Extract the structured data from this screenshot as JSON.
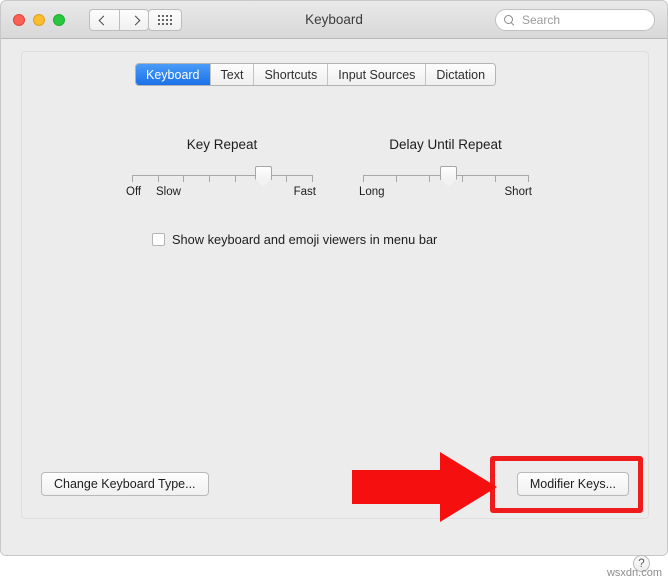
{
  "window": {
    "title": "Keyboard",
    "traffic_lights": [
      "close",
      "minimize",
      "maximize"
    ],
    "nav": {
      "back_icon": "chevron-left-icon",
      "forward_icon": "chevron-right-icon",
      "grid_icon": "show-all-grid-icon"
    },
    "search": {
      "placeholder": "Search",
      "value": "",
      "icon": "search-icon"
    }
  },
  "tabs": [
    {
      "label": "Keyboard",
      "active": true
    },
    {
      "label": "Text",
      "active": false
    },
    {
      "label": "Shortcuts",
      "active": false
    },
    {
      "label": "Input Sources",
      "active": false
    },
    {
      "label": "Dictation",
      "active": false
    }
  ],
  "sliders": [
    {
      "title": "Key Repeat",
      "left_label": "Off",
      "second_label": "Slow",
      "right_label": "Fast",
      "ticks": 8,
      "knob_percent": 73
    },
    {
      "title": "Delay Until Repeat",
      "left_label": "Long",
      "right_label": "Short",
      "ticks": 6,
      "knob_percent": 52
    }
  ],
  "checkbox": {
    "label": "Show keyboard and emoji viewers in menu bar",
    "checked": false
  },
  "buttons": {
    "change_keyboard_type": "Change Keyboard Type...",
    "modifier_keys": "Modifier Keys..."
  },
  "annotations": {
    "highlight_color": "#ee1c1c",
    "arrow_color": "#f60f0f",
    "arrow_points_to": "modifier-keys-button"
  },
  "help": {
    "label": "?"
  },
  "watermark": "wsxdn.com",
  "colors": {
    "window_bg": "#ececec",
    "titlebar_top": "#e9e9e9",
    "titlebar_bottom": "#d8d8d8",
    "accent_blue": "#1a71e8",
    "text": "#1d1d1d"
  }
}
